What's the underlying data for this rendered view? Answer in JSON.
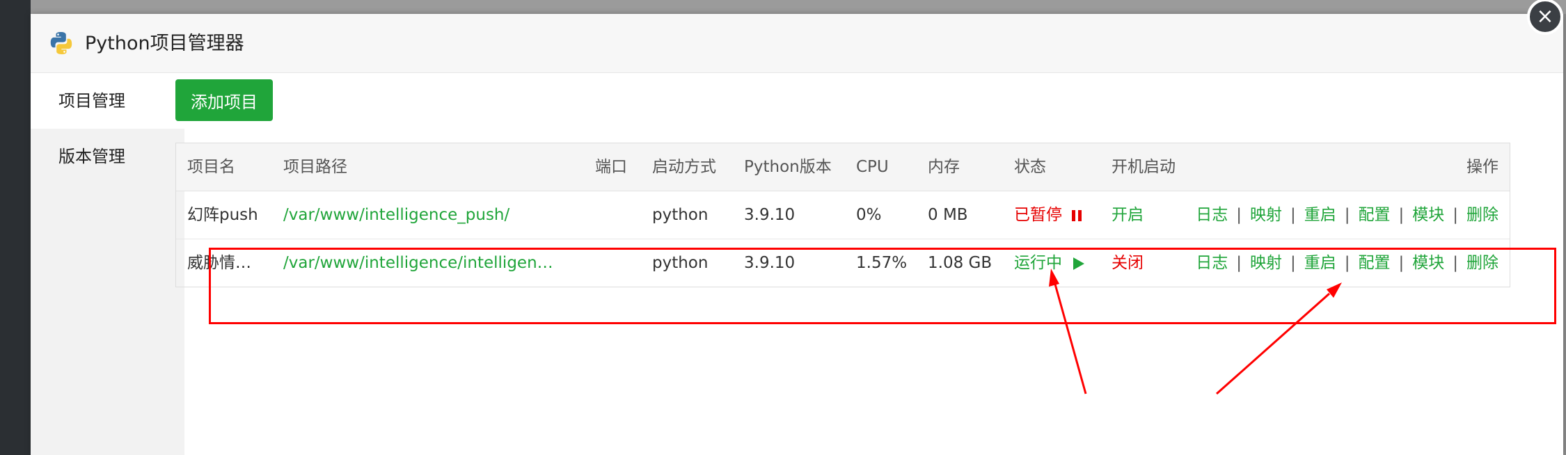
{
  "dialog": {
    "title": "Python项目管理器",
    "close_icon": "close-icon"
  },
  "sidebar": {
    "items": [
      {
        "label": "项目管理",
        "active": true
      },
      {
        "label": "版本管理",
        "active": false
      }
    ]
  },
  "toolbar": {
    "add_label": "添加项目"
  },
  "table": {
    "columns": [
      "项目名",
      "项目路径",
      "端口",
      "启动方式",
      "Python版本",
      "CPU",
      "内存",
      "状态",
      "开机启动",
      "操作"
    ],
    "rows": [
      {
        "name": "幻阵push",
        "path": "/var/www/intelligence_push/",
        "port": "",
        "start": "python",
        "pyver": "3.9.10",
        "cpu": "0%",
        "mem": "0 MB",
        "status": "已暂停",
        "status_icon": "pause-icon",
        "status_color": "#e60000",
        "boot": "开启",
        "boot_color": "#20a53a"
      },
      {
        "name": "威胁情…",
        "path": "/var/www/intelligence/intelligen…",
        "port": "",
        "start": "python",
        "pyver": "3.9.10",
        "cpu": "1.57%",
        "mem": "1.08 GB",
        "status": "运行中",
        "status_icon": "play-icon",
        "status_color": "#20a53a",
        "boot": "关闭",
        "boot_color": "#e60000"
      }
    ],
    "actions": [
      "日志",
      "映射",
      "重启",
      "配置",
      "模块",
      "删除"
    ]
  },
  "colors": {
    "accent": "#20a53a",
    "danger": "#e60000",
    "annotation": "#ff0000"
  }
}
